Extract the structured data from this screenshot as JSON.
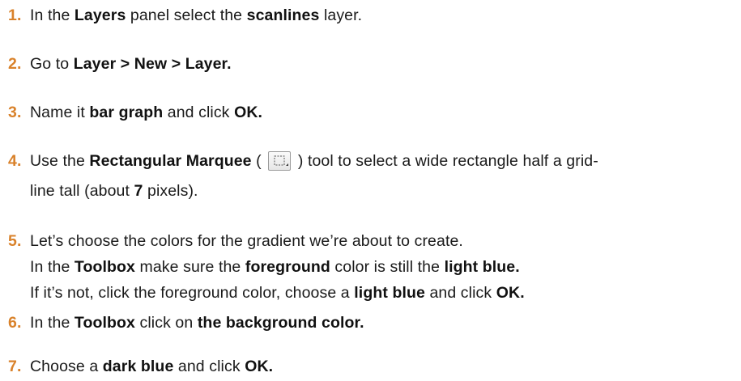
{
  "steps": [
    {
      "number": "1.",
      "segments": [
        {
          "t": "In the ",
          "b": false
        },
        {
          "t": "Layers",
          "b": true
        },
        {
          "t": " panel select the ",
          "b": false
        },
        {
          "t": "scanlines",
          "b": true
        },
        {
          "t": " layer.",
          "b": false
        }
      ]
    },
    {
      "number": "2.",
      "segments": [
        {
          "t": "Go to ",
          "b": false
        },
        {
          "t": "Layer > New > Layer.",
          "b": true
        }
      ]
    },
    {
      "number": "3.",
      "segments": [
        {
          "t": "Name it ",
          "b": false
        },
        {
          "t": "bar graph",
          "b": true
        },
        {
          "t": " and click ",
          "b": false
        },
        {
          "t": "OK.",
          "b": true
        }
      ]
    },
    {
      "number": "4.",
      "line1_before_icon": [
        {
          "t": "Use the ",
          "b": false
        },
        {
          "t": "Rectangular Marquee",
          "b": true
        },
        {
          "t": " (",
          "b": false
        }
      ],
      "icon": "rectangular-marquee-tool-icon",
      "line1_after_icon": [
        {
          "t": ") tool to select a wide rectangle half a grid-",
          "b": false
        }
      ],
      "line2": [
        {
          "t": "line tall (about ",
          "b": false
        },
        {
          "t": "7",
          "b": true
        },
        {
          "t": " pixels).",
          "b": false
        }
      ]
    },
    {
      "number": "5.",
      "lines": [
        [
          {
            "t": "Let’s choose the colors for the gradient we’re about to create.",
            "b": false
          }
        ],
        [
          {
            "t": "In the ",
            "b": false
          },
          {
            "t": "Toolbox",
            "b": true
          },
          {
            "t": " make sure the ",
            "b": false
          },
          {
            "t": "foreground",
            "b": true
          },
          {
            "t": " color is still the ",
            "b": false
          },
          {
            "t": "light blue.",
            "b": true
          }
        ],
        [
          {
            "t": "If it’s not, click the foreground color, choose a ",
            "b": false
          },
          {
            "t": "light blue",
            "b": true
          },
          {
            "t": " and click ",
            "b": false
          },
          {
            "t": "OK.",
            "b": true
          }
        ]
      ]
    },
    {
      "number": "6.",
      "segments": [
        {
          "t": "In the ",
          "b": false
        },
        {
          "t": "Toolbox",
          "b": true
        },
        {
          "t": " click on ",
          "b": false
        },
        {
          "t": "the background color.",
          "b": true
        }
      ]
    },
    {
      "number": "7.",
      "segments": [
        {
          "t": "Choose a ",
          "b": false
        },
        {
          "t": "dark blue",
          "b": true
        },
        {
          "t": " and click ",
          "b": false
        },
        {
          "t": "OK.",
          "b": true
        }
      ]
    }
  ],
  "colors": {
    "number": "#d9822b",
    "text": "#1a1a1a"
  }
}
